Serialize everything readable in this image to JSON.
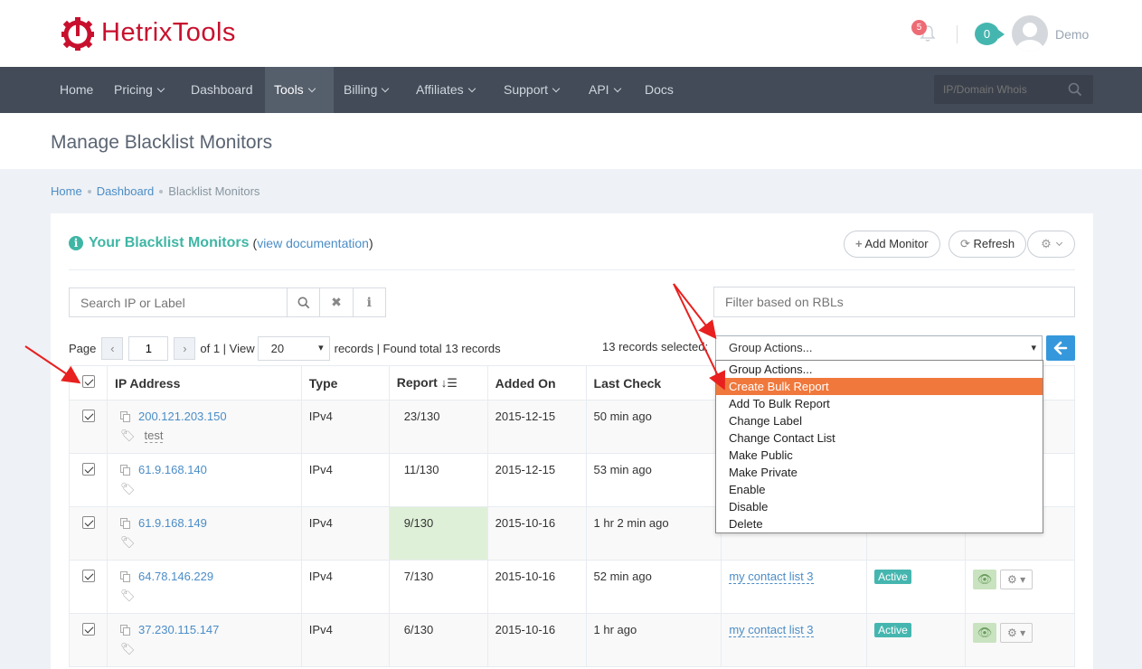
{
  "brand": {
    "name": "HetrixTools",
    "color": "#c8102e"
  },
  "header": {
    "notifications": "5",
    "messages": "0",
    "username": "Demo"
  },
  "nav": {
    "items": [
      {
        "label": "Home"
      },
      {
        "label": "Pricing"
      },
      {
        "label": "Dashboard"
      },
      {
        "label": "Tools"
      },
      {
        "label": "Billing"
      },
      {
        "label": "Affiliates"
      },
      {
        "label": "Support"
      },
      {
        "label": "API"
      },
      {
        "label": "Docs"
      }
    ],
    "search_placeholder": "IP/Domain Whois"
  },
  "page": {
    "title": "Manage Blacklist Monitors"
  },
  "breadcrumb": {
    "home": "Home",
    "dashboard": "Dashboard",
    "current": "Blacklist Monitors"
  },
  "panel": {
    "title": "Your Blacklist Monitors",
    "doc_open": "(",
    "doc_link": "view documentation",
    "doc_close": ")",
    "add_monitor": "Add Monitor",
    "refresh": "Refresh"
  },
  "filters": {
    "search_placeholder": "Search IP or Label",
    "rbl_placeholder": "Filter based on RBLs"
  },
  "pager": {
    "page_label": "Page",
    "page_value": "1",
    "of_text": "of 1 | View",
    "view_value": "20",
    "records_text": "records | Found total 13 records"
  },
  "selection": {
    "label": "13 records selected:",
    "group_action": "Group Actions..."
  },
  "group_actions": [
    "Group Actions...",
    "Create Bulk Report",
    "Add To Bulk Report",
    "Change Label",
    "Change Contact List",
    "Make Public",
    "Make Private",
    "Enable",
    "Disable",
    "Delete"
  ],
  "table": {
    "headers": {
      "ip": "IP Address",
      "type": "Type",
      "report": "Report",
      "added": "Added On",
      "last": "Last Check"
    },
    "rows": [
      {
        "ip": "200.121.203.150",
        "label": "test",
        "type": "IPv4",
        "report": "23/130",
        "added": "2015-12-15",
        "last": "50 min ago",
        "contact": "",
        "status": ""
      },
      {
        "ip": "61.9.168.140",
        "label": "",
        "type": "IPv4",
        "report": "11/130",
        "added": "2015-12-15",
        "last": "53 min ago",
        "contact": "",
        "status": ""
      },
      {
        "ip": "61.9.168.149",
        "label": "",
        "type": "IPv4",
        "report": "9/130",
        "added": "2015-10-16",
        "last": "1 hr 2 min ago",
        "contact": "",
        "status": ""
      },
      {
        "ip": "64.78.146.229",
        "label": "",
        "type": "IPv4",
        "report": "7/130",
        "added": "2015-10-16",
        "last": "52 min ago",
        "contact": "my contact list 3",
        "status": "Active"
      },
      {
        "ip": "37.230.115.147",
        "label": "",
        "type": "IPv4",
        "report": "6/130",
        "added": "2015-10-16",
        "last": "1 hr ago",
        "contact": "my contact list 3",
        "status": "Active"
      }
    ]
  },
  "colors": {
    "accent": "#3fb6a5",
    "link": "#4b8dc7",
    "nav": "#434b58",
    "highlight": "#f0783c",
    "arrow": "#e8201f",
    "report_red": "#e02222"
  }
}
